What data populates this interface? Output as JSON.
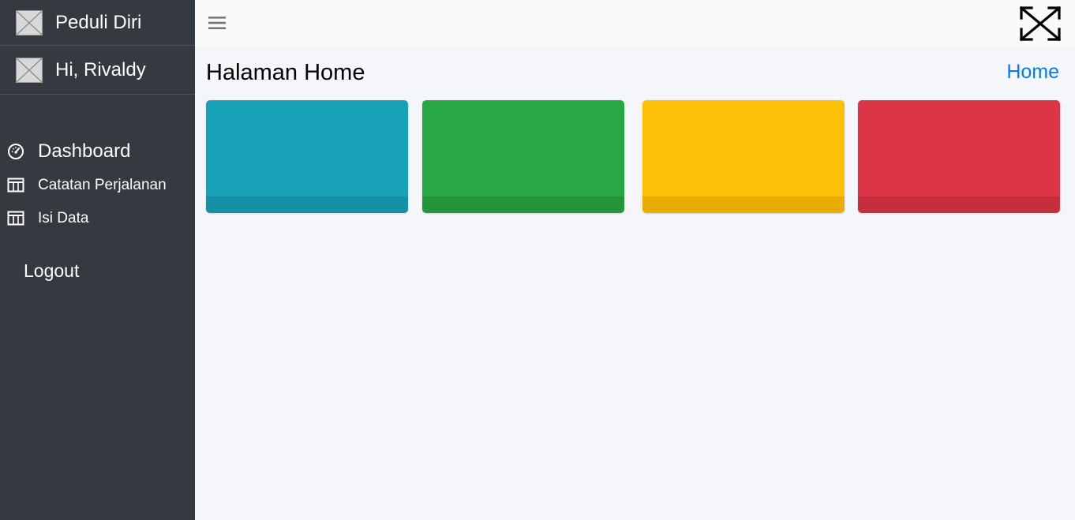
{
  "sidebar": {
    "brand": {
      "text": "Peduli Diri",
      "logo_icon": "broken-image-icon"
    },
    "user": {
      "text": "Hi, Rivaldy",
      "avatar_icon": "broken-image-icon"
    },
    "nav": [
      {
        "label": "Dashboard",
        "icon": "dashboard-gauge-icon"
      },
      {
        "label": "Catatan Perjalanan",
        "icon": "table-icon"
      },
      {
        "label": "Isi Data",
        "icon": "table-icon"
      }
    ],
    "logout": "Logout"
  },
  "topbar": {
    "menu_icon": "hamburger-icon",
    "fullscreen_icon": "expand-arrows-icon"
  },
  "content": {
    "title": "Halaman Home",
    "breadcrumb": "Home"
  },
  "cards": [
    {
      "color": "#17a2b8"
    },
    {
      "color": "#28a745"
    },
    {
      "color": "#ffc107"
    },
    {
      "color": "#dc3545"
    }
  ],
  "colors": {
    "sidebar_bg": "#343a40",
    "content_bg": "#f4f6f9",
    "link": "#007bff"
  }
}
